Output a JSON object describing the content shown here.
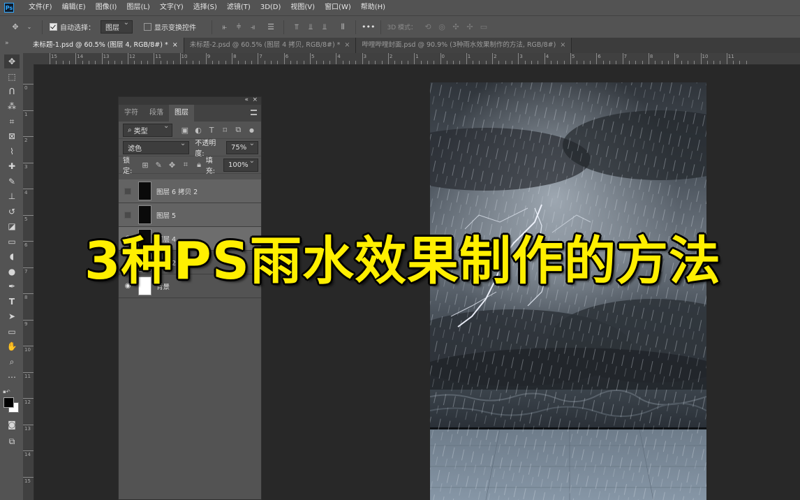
{
  "app": {
    "logo": "Ps"
  },
  "menu": [
    "文件(F)",
    "编辑(E)",
    "图像(I)",
    "图层(L)",
    "文字(Y)",
    "选择(S)",
    "滤镜(T)",
    "3D(D)",
    "视图(V)",
    "窗口(W)",
    "帮助(H)"
  ],
  "options": {
    "auto_select_label": "自动选择：",
    "auto_select_value": "图层",
    "show_transform_label": "显示变换控件",
    "more": "•••",
    "mode3d_label": "3D 模式："
  },
  "tabs": [
    {
      "label": "未标题-1.psd @ 60.5% (图层 4, RGB/8#) *",
      "close": "×"
    },
    {
      "label": "未标题-2.psd @ 60.5% (图层 4 拷贝, RGB/8#) *",
      "close": "×"
    },
    {
      "label": "哔哩哔哩封面.psd @ 90.9% (3种雨水效果制作的方法, RGB/8#)",
      "close": "×"
    }
  ],
  "ruler_h": [
    "15",
    "14",
    "13",
    "12",
    "11",
    "10",
    "9",
    "8",
    "7",
    "6",
    "5",
    "4",
    "3",
    "2",
    "1",
    "0",
    "1",
    "2",
    "3",
    "4",
    "5",
    "6",
    "7",
    "8",
    "9",
    "10",
    "11"
  ],
  "ruler_v": [
    "0",
    "1",
    "2",
    "3",
    "4",
    "5",
    "6",
    "7",
    "8",
    "9",
    "10",
    "11",
    "12",
    "13",
    "14",
    "15"
  ],
  "panel": {
    "tabs": [
      "字符",
      "段落",
      "图层"
    ],
    "filter_kind": "类型",
    "blend_mode": "滤色",
    "opacity_label": "不透明度:",
    "opacity_value": "75%",
    "lock_label": "锁定:",
    "fill_label": "填充:",
    "fill_value": "100%",
    "layers": [
      {
        "name": "图层 6 拷贝 2"
      },
      {
        "name": "图层 5"
      },
      {
        "name": "图层 4"
      },
      {
        "name": "图层 2"
      },
      {
        "name": "背景"
      }
    ]
  },
  "headline": "3种PS雨水效果制作的方法",
  "colors": {
    "headline": "#ffef00",
    "accent": "#31a8ff"
  }
}
